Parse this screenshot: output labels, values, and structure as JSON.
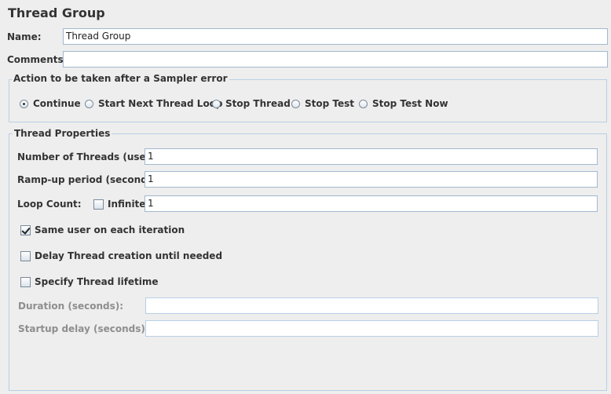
{
  "panel": {
    "title": "Thread Group"
  },
  "name_field": {
    "label": "Name:",
    "value": "Thread Group"
  },
  "comments_field": {
    "label": "Comments:",
    "value": ""
  },
  "sampler_error": {
    "legend": "Action to be taken after a Sampler error",
    "options": [
      {
        "label": "Continue",
        "selected": true
      },
      {
        "label": "Start Next Thread Loop",
        "selected": false
      },
      {
        "label": "Stop Thread",
        "selected": false
      },
      {
        "label": "Stop Test",
        "selected": false
      },
      {
        "label": "Stop Test Now",
        "selected": false
      }
    ]
  },
  "thread_properties": {
    "legend": "Thread Properties",
    "num_threads": {
      "label": "Number of Threads (users):",
      "value": "1"
    },
    "ramp_up": {
      "label": "Ramp-up period (seconds):",
      "value": "1"
    },
    "loop_count": {
      "label": "Loop Count:",
      "infinite_label": "Infinite",
      "infinite_checked": false,
      "value": "1"
    },
    "same_user": {
      "label": "Same user on each iteration",
      "checked": true
    },
    "delay_creation": {
      "label": "Delay Thread creation until needed",
      "checked": false
    },
    "specify_lifetime": {
      "label": "Specify Thread lifetime",
      "checked": false
    },
    "duration": {
      "label": "Duration (seconds):",
      "value": ""
    },
    "startup_delay": {
      "label": "Startup delay (seconds):",
      "value": ""
    }
  }
}
